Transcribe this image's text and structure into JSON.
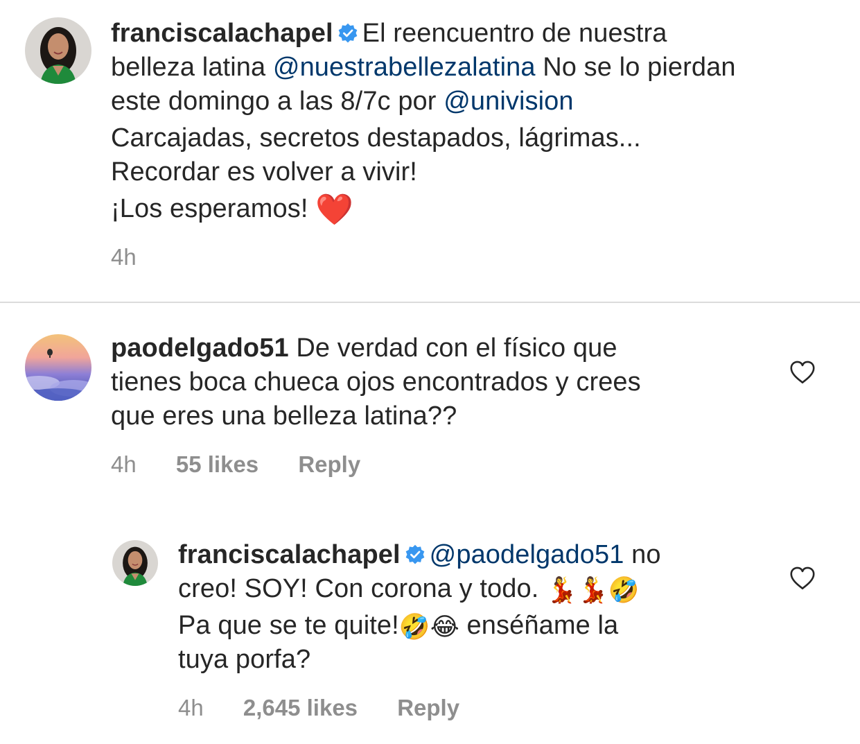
{
  "caption": {
    "username": "franciscalachapel",
    "verified": true,
    "avatar_icon": "profile-photo-woman",
    "line1_rest": "El reencuentro de nuestra",
    "line2_pre": "belleza latina ",
    "line2_mention": "@nuestrabellezalatina",
    "line2_post": " No se lo pierdan",
    "line3_pre": "este domingo a las 8/7c por ",
    "line3_mention": "@univision",
    "line4": "Carcajadas, secretos destapados, lágrimas...",
    "line5": "Recordar es volver a vivir!",
    "line6": "¡Los esperamos! ",
    "line6_emoji": "❤️",
    "time": "4h"
  },
  "comment1": {
    "username": "paodelgado51",
    "avatar_icon": "profile-photo-balloon-sky",
    "line1_rest": "De verdad con el físico que",
    "line2": "tienes boca chueca ojos encontrados y crees",
    "line3": "que eres una belleza latina??",
    "time": "4h",
    "likes": "55 likes",
    "reply": "Reply",
    "like_icon": "heart-outline-icon"
  },
  "reply1": {
    "username": "franciscalachapel",
    "verified": true,
    "avatar_icon": "profile-photo-woman",
    "mention": "@paodelgado51",
    "line1_post": " no",
    "line2": "creo! SOY! Con corona y todo. ",
    "line2_emoji": "💃💃🤣",
    "line3_pre": "Pa que se te quite!",
    "line3_emoji": "🤣😂",
    "line3_post": " enséñame la",
    "line4": "tuya porfa?",
    "time": "4h",
    "likes": "2,645 likes",
    "reply": "Reply",
    "like_icon": "heart-outline-icon"
  },
  "colors": {
    "text": "#262626",
    "secondary": "#8e8e8e",
    "mention": "#00376b",
    "verified_badge": "#3897f0",
    "divider": "#dbdbdb"
  }
}
